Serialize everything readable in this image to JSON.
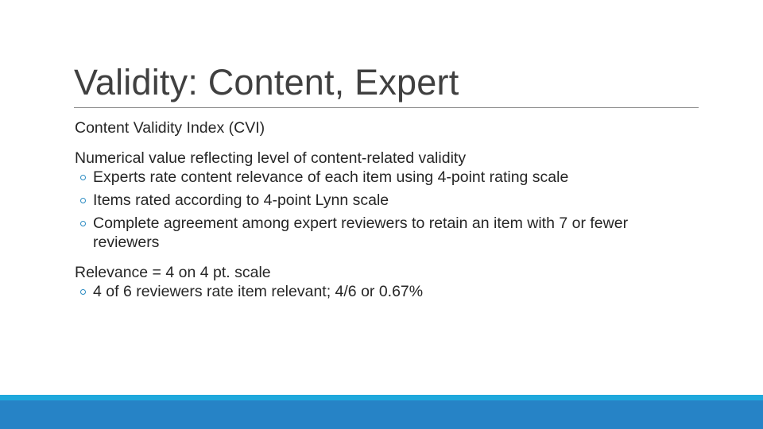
{
  "slide": {
    "title": "Validity: Content, Expert",
    "subheading": "Content Validity Index (CVI)",
    "sections": [
      {
        "text": "Numerical value reflecting level of content-related validity",
        "bullets": [
          "Experts rate content relevance of each item using 4-point rating scale",
          "Items rated according to 4-point Lynn scale",
          "Complete agreement among expert reviewers to retain an item with 7 or fewer reviewers"
        ]
      },
      {
        "text": "Relevance = 4 on 4 pt. scale",
        "bullets": [
          "4 of 6 reviewers rate item relevant; 4/6 or 0.67%"
        ]
      }
    ],
    "bullet_icon": "hollow-circle-bullet",
    "colors": {
      "title": "#404040",
      "text": "#262626",
      "bullet": "#2b8bc2",
      "footer_light": "#1fa8dc",
      "footer_dark": "#2683c6"
    }
  }
}
